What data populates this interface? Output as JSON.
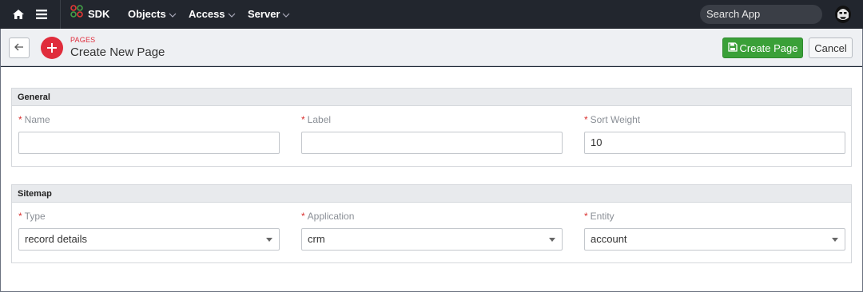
{
  "nav": {
    "sdk_label": "SDK",
    "objects_label": "Objects",
    "access_label": "Access",
    "server_label": "Server",
    "search_placeholder": "Search App"
  },
  "header": {
    "kicker": "PAGES",
    "title": "Create New Page",
    "create_label": "Create Page",
    "cancel_label": "Cancel"
  },
  "general": {
    "heading": "General",
    "name": {
      "label": "Name",
      "value": ""
    },
    "label": {
      "label": "Label",
      "value": ""
    },
    "sort_weight": {
      "label": "Sort Weight",
      "value": "10"
    }
  },
  "sitemap": {
    "heading": "Sitemap",
    "type": {
      "label": "Type",
      "value": "record details"
    },
    "application": {
      "label": "Application",
      "value": "crm"
    },
    "entity": {
      "label": "Entity",
      "value": "account"
    }
  },
  "required_mark": "*",
  "colors": {
    "nav_bg": "#22262e",
    "accent_red": "#e02d3c",
    "create_green": "#3aa038"
  }
}
